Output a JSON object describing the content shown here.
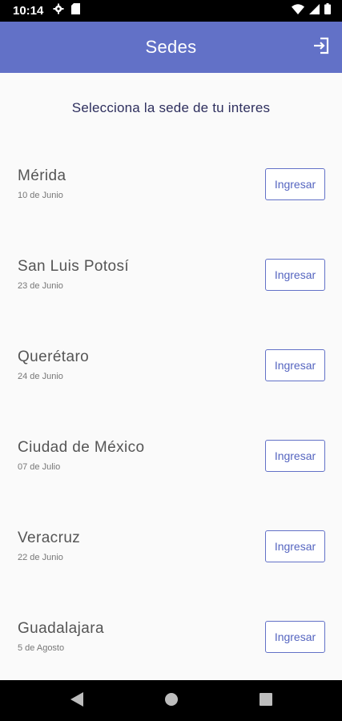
{
  "status_bar": {
    "time": "10:14",
    "icons": [
      "gear-icon",
      "sd-card-icon",
      "wifi-icon",
      "signal-icon",
      "battery-icon"
    ]
  },
  "app_bar": {
    "title": "Sedes",
    "background": "#6271c7",
    "action_icon": "logout-icon"
  },
  "main": {
    "subtitle": "Selecciona la sede de tu interes",
    "venues": [
      {
        "name": "Mérida",
        "date": "10 de Junio",
        "button_label": "Ingresar"
      },
      {
        "name": "San Luis Potosí",
        "date": "23 de Junio",
        "button_label": "Ingresar"
      },
      {
        "name": "Querétaro",
        "date": "24 de Junio",
        "button_label": "Ingresar"
      },
      {
        "name": "Ciudad de México",
        "date": "07 de Julio",
        "button_label": "Ingresar"
      },
      {
        "name": "Veracruz",
        "date": "22 de Junio",
        "button_label": "Ingresar"
      },
      {
        "name": "Guadalajara",
        "date": "5 de Agosto",
        "button_label": "Ingresar"
      }
    ]
  },
  "nav_bar": {
    "icons": [
      "back-icon",
      "home-icon",
      "recents-icon"
    ]
  }
}
